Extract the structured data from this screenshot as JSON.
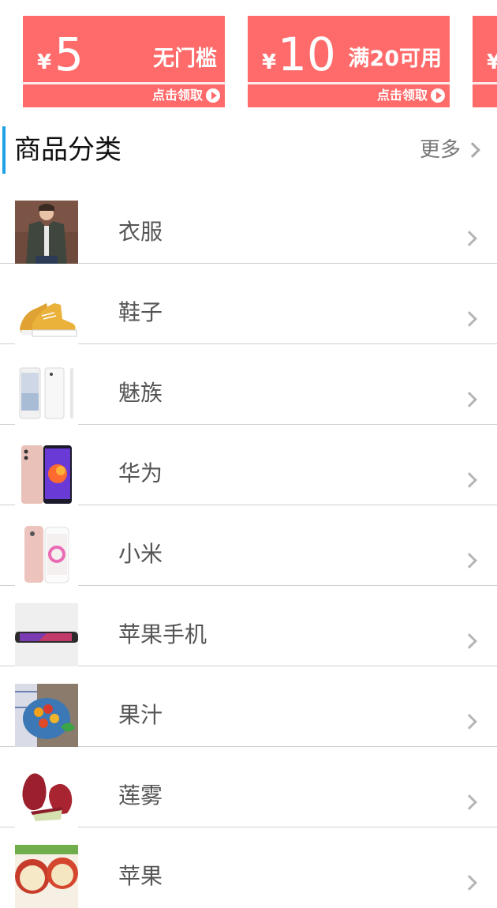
{
  "coupons": [
    {
      "currency": "¥",
      "amount": "5",
      "condition": "无门槛",
      "claim": "点击领取"
    },
    {
      "currency": "¥",
      "amount": "10",
      "condition": "满20可用",
      "claim": "点击领取"
    },
    {
      "currency": "¥"
    }
  ],
  "section": {
    "title": "商品分类",
    "more": "更多"
  },
  "categories": [
    {
      "label": "衣服",
      "thumb": "jacket"
    },
    {
      "label": "鞋子",
      "thumb": "sneaker"
    },
    {
      "label": "魅族",
      "thumb": "phone-white"
    },
    {
      "label": "华为",
      "thumb": "phone-pink"
    },
    {
      "label": "小米",
      "thumb": "phone-rose"
    },
    {
      "label": "苹果手机",
      "thumb": "phone-x"
    },
    {
      "label": "果汁",
      "thumb": "fruit-bowl"
    },
    {
      "label": "莲雾",
      "thumb": "wax-apple"
    },
    {
      "label": "苹果",
      "thumb": "apple"
    }
  ],
  "colors": {
    "coupon": "#ff6b6b",
    "accent": "#1ea0e6"
  }
}
